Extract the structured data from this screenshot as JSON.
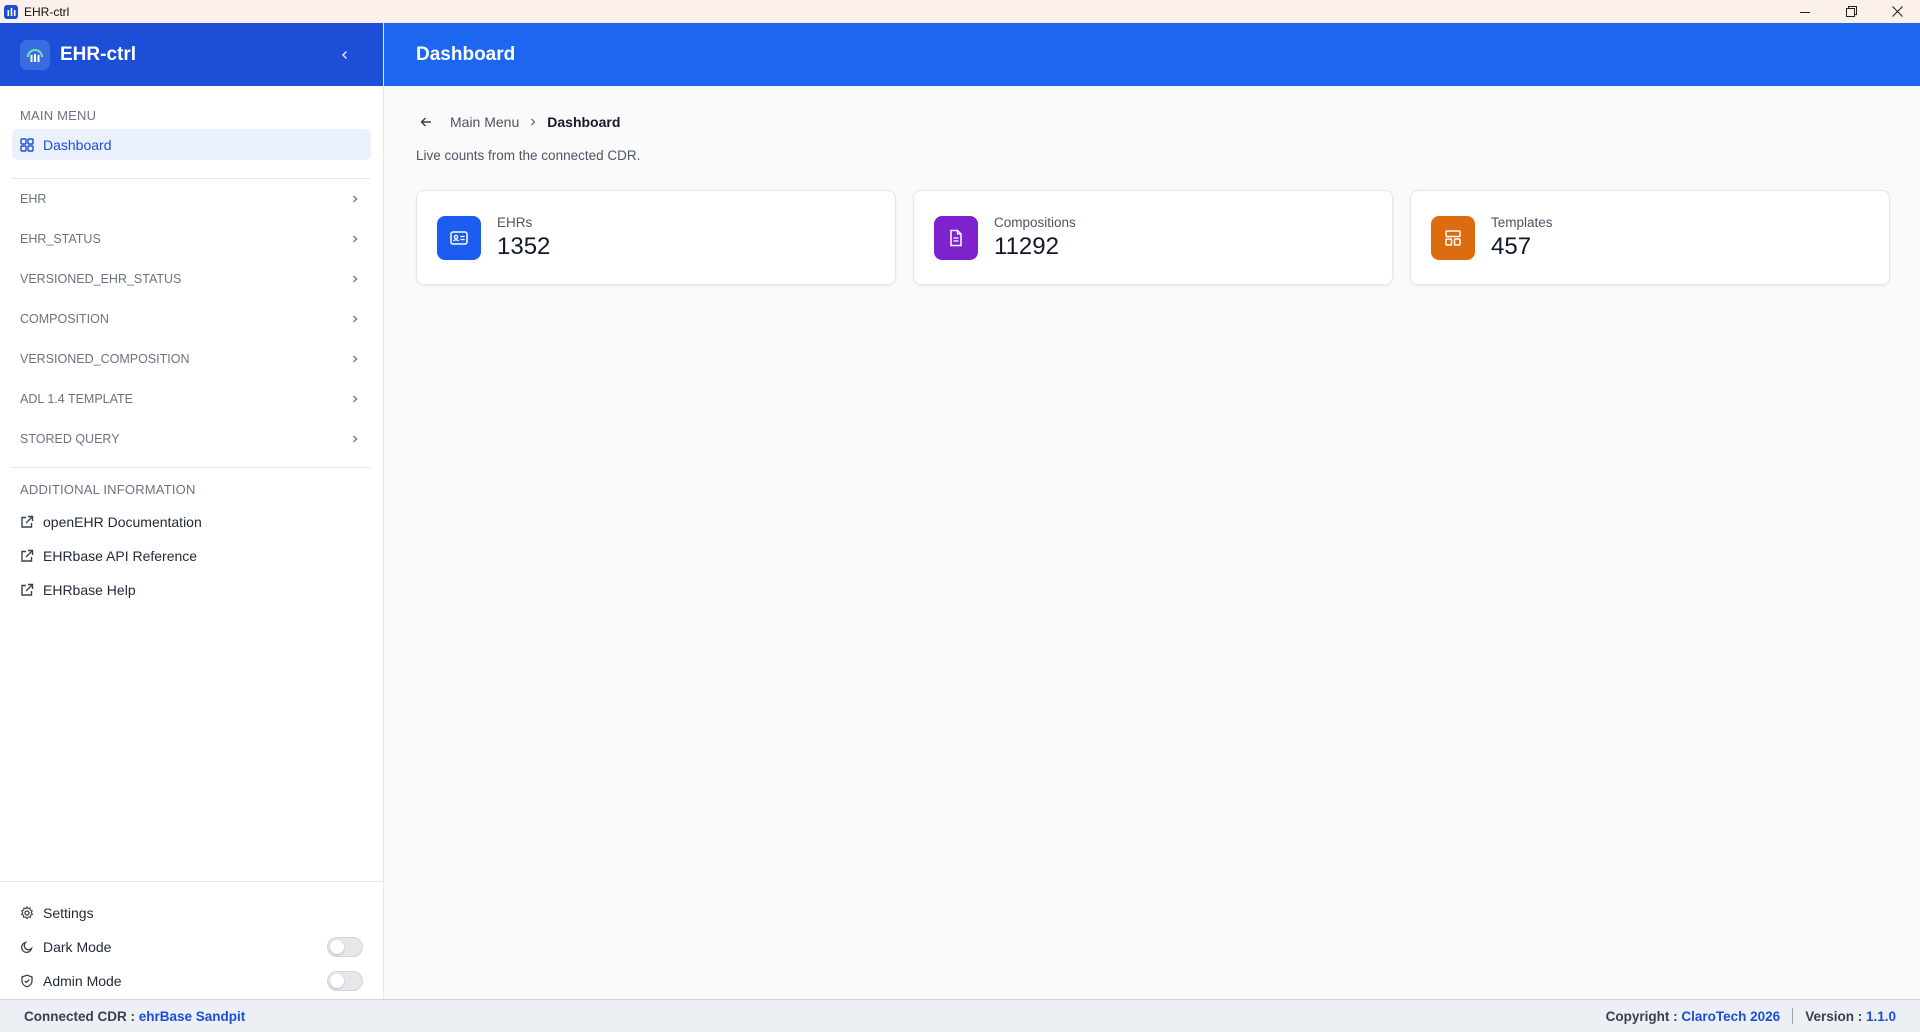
{
  "window": {
    "title": "EHR-ctrl"
  },
  "sidebar": {
    "brand": "EHR-ctrl",
    "main_menu_label": "MAIN MENU",
    "active_item": "Dashboard",
    "groups": [
      {
        "label": "EHR"
      },
      {
        "label": "EHR_STATUS"
      },
      {
        "label": "VERSIONED_EHR_STATUS"
      },
      {
        "label": "COMPOSITION"
      },
      {
        "label": "VERSIONED_COMPOSITION"
      },
      {
        "label": "ADL 1.4 TEMPLATE"
      },
      {
        "label": "STORED QUERY"
      }
    ],
    "additional_label": "ADDITIONAL INFORMATION",
    "links": [
      {
        "label": "openEHR Documentation"
      },
      {
        "label": "EHRbase API Reference"
      },
      {
        "label": "EHRbase Help"
      }
    ],
    "bottom": {
      "settings": "Settings",
      "dark_mode": "Dark Mode",
      "admin_mode": "Admin Mode"
    }
  },
  "header": {
    "title": "Dashboard"
  },
  "breadcrumb": {
    "parent": "Main Menu",
    "current": "Dashboard"
  },
  "subtitle": "Live counts from the connected CDR.",
  "cards": [
    {
      "label": "EHRs",
      "value": "1352",
      "color": "#1d5cf0"
    },
    {
      "label": "Compositions",
      "value": "11292",
      "color": "#7e22ce"
    },
    {
      "label": "Templates",
      "value": "457",
      "color": "#dd6b10"
    }
  ],
  "statusbar": {
    "connected_label": "Connected CDR : ",
    "connected_value": "ehrBase Sandpit",
    "copyright_label": "Copyright : ",
    "copyright_value": "ClaroTech 2026",
    "version_label": "Version : ",
    "version_value": "1.1.0"
  },
  "colors": {
    "brand": "#1d4ed8",
    "header": "#1d66f0",
    "accent": "#1d4ed8"
  }
}
